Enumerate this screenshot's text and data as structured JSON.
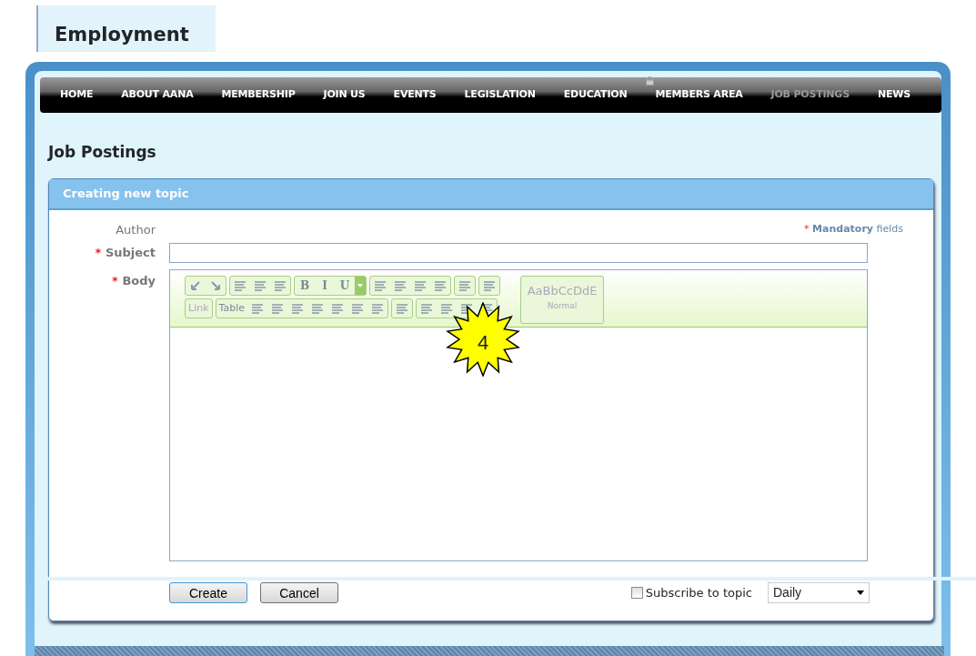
{
  "page_title": "Employment",
  "nav": [
    {
      "label": "HOME",
      "selected": false
    },
    {
      "label": "ABOUT AANA",
      "selected": false
    },
    {
      "label": "MEMBERSHIP",
      "selected": false
    },
    {
      "label": "JOIN US",
      "selected": false
    },
    {
      "label": "EVENTS",
      "selected": false
    },
    {
      "label": "LEGISLATION",
      "selected": false
    },
    {
      "label": "EDUCATION",
      "selected": false
    },
    {
      "label": "MEMBERS AREA",
      "selected": false,
      "locked": true
    },
    {
      "label": "JOB POSTINGS",
      "selected": true
    },
    {
      "label": "NEWS",
      "selected": false
    }
  ],
  "section_title": "Job Postings",
  "panel": {
    "title": "Creating new topic",
    "author_label": "Author",
    "mandatory_mark": "*",
    "mandatory_word": "Mandatory",
    "mandatory_rest": "fields",
    "subject_label": "Subject",
    "body_label": "Body",
    "toolbar": [
      [
        [
          {
            "kind": "icon"
          },
          {
            "kind": "icon"
          }
        ],
        [
          {
            "kind": "icon"
          },
          {
            "kind": "icon"
          },
          {
            "kind": "icon"
          }
        ],
        [
          {
            "kind": "text",
            "label": "B"
          },
          {
            "kind": "text",
            "label": "I"
          },
          {
            "kind": "text",
            "label": "U"
          },
          {
            "kind": "caret"
          }
        ],
        [
          {
            "kind": "icon"
          },
          {
            "kind": "icon"
          },
          {
            "kind": "icon"
          },
          {
            "kind": "icon"
          }
        ],
        [
          {
            "kind": "icon"
          }
        ],
        [
          {
            "kind": "icon"
          }
        ]
      ],
      [
        [
          {
            "kind": "text",
            "label": "Link"
          }
        ],
        [
          {
            "kind": "text",
            "label": "Table"
          },
          {
            "kind": "icon"
          },
          {
            "kind": "icon"
          },
          {
            "kind": "icon"
          },
          {
            "kind": "icon"
          },
          {
            "kind": "icon"
          },
          {
            "kind": "icon"
          },
          {
            "kind": "icon"
          }
        ],
        [
          {
            "kind": "icon"
          }
        ],
        [
          {
            "kind": "icon"
          },
          {
            "kind": "icon"
          },
          {
            "kind": "icon"
          },
          {
            "kind": "icon"
          }
        ]
      ]
    ],
    "style_preview": "AaBbCcDdE",
    "style_name": "Normal",
    "callout": "4",
    "create": "Create",
    "cancel": "Cancel",
    "subscribe": {
      "label": "Subscribe to topic",
      "checked": false
    },
    "frequency": "Daily"
  }
}
